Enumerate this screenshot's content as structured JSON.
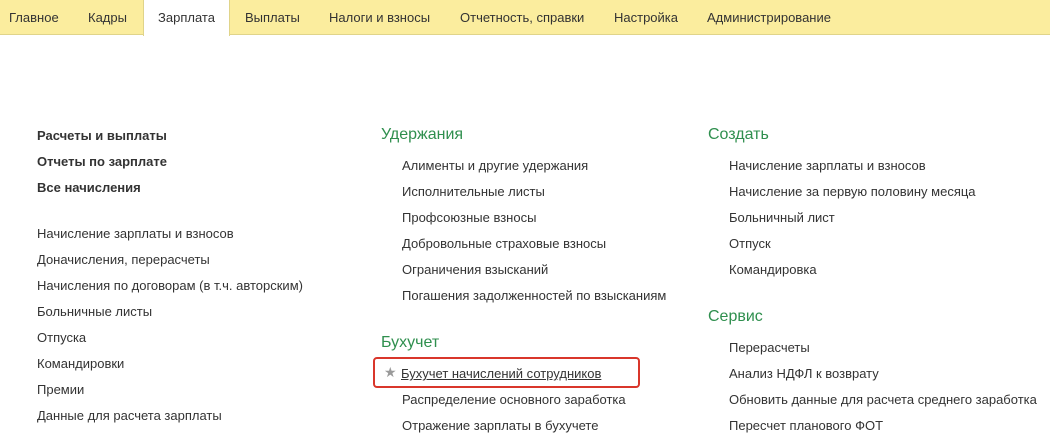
{
  "menu": {
    "tabs": [
      {
        "label": "Главное"
      },
      {
        "label": "Кадры"
      },
      {
        "label": "Зарплата"
      },
      {
        "label": "Выплаты"
      },
      {
        "label": "Налоги и взносы"
      },
      {
        "label": "Отчетность, справки"
      },
      {
        "label": "Настройка"
      },
      {
        "label": "Администрирование"
      }
    ],
    "active": "Зарплата"
  },
  "left": {
    "bold_items": [
      "Расчеты и выплаты",
      "Отчеты по зарплате",
      "Все начисления"
    ],
    "items": [
      "Начисление зарплаты и взносов",
      "Доначисления, перерасчеты",
      "Начисления по договорам (в т.ч. авторским)",
      "Больничные листы",
      "Отпуска",
      "Командировки",
      "Премии",
      "Данные для расчета зарплаты"
    ]
  },
  "middle": {
    "deductions": {
      "title": "Удержания",
      "items": [
        "Алименты и другие удержания",
        "Исполнительные листы",
        "Профсоюзные взносы",
        "Добровольные страховые взносы",
        "Ограничения взысканий",
        "Погашения задолженностей по взысканиям"
      ]
    },
    "accounting": {
      "title": "Бухучет",
      "items": [
        "Бухучет начислений сотрудников",
        "Распределение основного заработка",
        "Отражение зарплаты в бухучете"
      ]
    }
  },
  "right": {
    "create": {
      "title": "Создать",
      "items": [
        "Начисление зарплаты и взносов",
        "Начисление за первую половину месяца",
        "Больничный лист",
        "Отпуск",
        "Командировка"
      ]
    },
    "service": {
      "title": "Сервис",
      "items": [
        "Перерасчеты",
        "Анализ НДФЛ к возврату",
        "Обновить данные для расчета среднего заработка",
        "Пересчет планового ФОТ"
      ]
    }
  },
  "colors": {
    "menubar": "#fbed9e",
    "section_title": "#2f8f4e",
    "highlight": "#d9362b"
  }
}
